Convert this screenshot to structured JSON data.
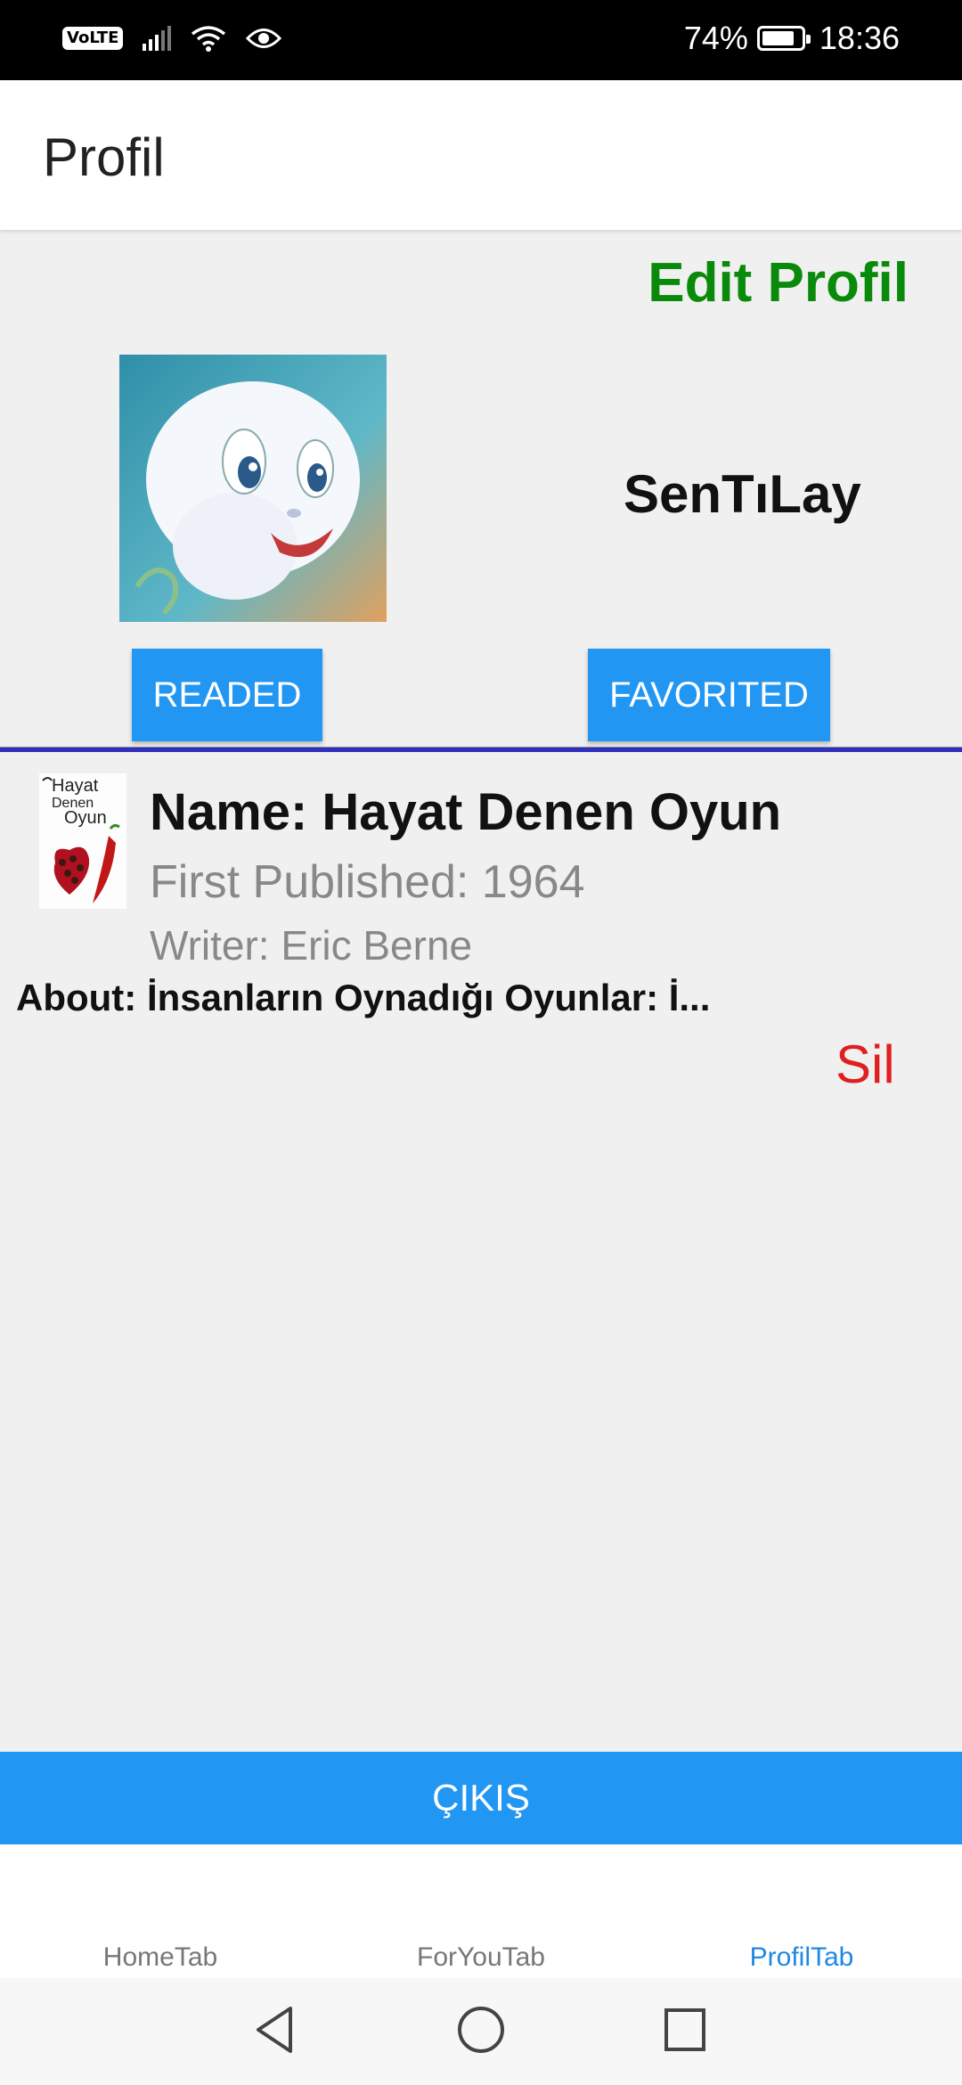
{
  "status_bar": {
    "volte": "VoLTE",
    "battery_percent": "74%",
    "battery_level": 0.74,
    "time": "18:36",
    "icons": [
      "signal-icon",
      "wifi-icon",
      "eye-icon",
      "battery-charging-icon"
    ]
  },
  "app_bar": {
    "title": "Profil"
  },
  "profile": {
    "edit_label": "Edit Profil",
    "username": "SenTıLay",
    "readed_button": "READED",
    "favorited_button": "FAVORITED"
  },
  "books": [
    {
      "cover_title": "Hayat Denen Oyun",
      "name": "Name: Hayat Denen Oyun",
      "first_published": "First Published: 1964",
      "writer": "Writer: Eric Berne",
      "about": "About: İnsanların Oynadığı Oyunlar: İ...",
      "delete_label": "Sil"
    }
  ],
  "logout_button": "ÇIKIŞ",
  "tabs": [
    {
      "label": "HomeTab",
      "active": false
    },
    {
      "label": "ForYouTab",
      "active": false
    },
    {
      "label": "ProfilTab",
      "active": true
    }
  ],
  "colors": {
    "accent": "#2196f3",
    "edit": "#0a8a0a",
    "delete": "#e02020",
    "active_tab": "#1e88e5"
  },
  "nav_icons": [
    "back-icon",
    "home-icon",
    "recents-icon"
  ]
}
